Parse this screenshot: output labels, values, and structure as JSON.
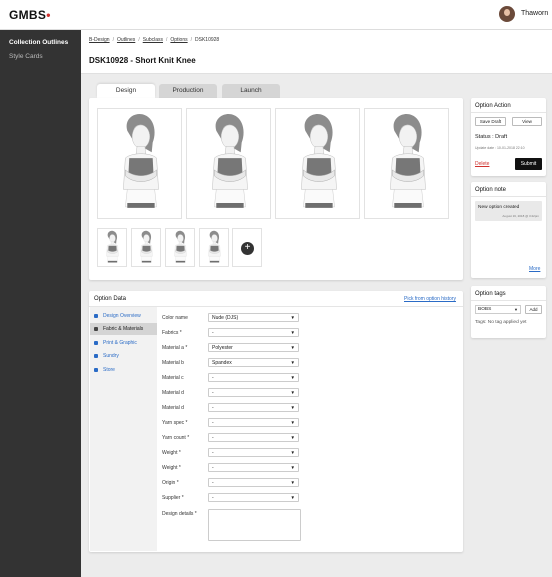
{
  "app": {
    "logo_text": "GMBS",
    "logo_dot": "•",
    "user_name": "Thaworn",
    "accent": "#d0312d"
  },
  "sidebar": {
    "items": [
      {
        "label": "Collection Outlines",
        "active": true
      },
      {
        "label": "Style Cards",
        "active": false
      }
    ]
  },
  "breadcrumb": {
    "items": [
      "B-Design",
      "Outlines",
      "Subclass",
      "Options",
      "DSK10928"
    ],
    "separator": "/"
  },
  "page": {
    "title": "DSK10928 - Short Knit Knee"
  },
  "tabs": [
    {
      "label": "Design",
      "active": true
    },
    {
      "label": "Production",
      "active": false
    },
    {
      "label": "Launch",
      "active": false
    }
  ],
  "gallery": {
    "add_icon": "+"
  },
  "option_action": {
    "title": "Option Action",
    "save_label": "Save Draft",
    "view_label": "View",
    "status_label": "Status : Draft",
    "update_date": "Update date : 10-01-2018 22:10",
    "delete_label": "Delete",
    "submit_label": "Submit"
  },
  "option_note": {
    "title": "Option note",
    "note_text": "New option created",
    "note_date": "August 16, 2018 @ 3:22pm",
    "more_label": "More"
  },
  "option_tags": {
    "title": "Option tags",
    "select_value": "BOBS",
    "add_label": "Add",
    "tags_text": "Tags: No tag applied yet"
  },
  "option_data": {
    "title": "Option Data",
    "pick_link": "Pick from option history",
    "tabs": [
      {
        "label": "Design Overview",
        "icon": "home-icon",
        "active": false
      },
      {
        "label": "Fabric & Materials",
        "icon": "grid-icon",
        "active": true
      },
      {
        "label": "Print & Graphic",
        "icon": "image-icon",
        "active": false
      },
      {
        "label": "Sundry",
        "icon": "sundry-icon",
        "active": false
      },
      {
        "label": "Store",
        "icon": "store-icon",
        "active": false
      }
    ],
    "fields": [
      {
        "label": "Color name",
        "value": "Nude (DJS)"
      },
      {
        "label": "Fabrics *",
        "value": "-"
      },
      {
        "label": "Material a *",
        "value": "Polyester"
      },
      {
        "label": "Material b",
        "value": "Spandex"
      },
      {
        "label": "Material c",
        "value": "-"
      },
      {
        "label": "Material d",
        "value": "-"
      },
      {
        "label": "Material d",
        "value": "-"
      },
      {
        "label": "Yarn spec *",
        "value": "-"
      },
      {
        "label": "Yarn count *",
        "value": "-"
      },
      {
        "label": "Weight *",
        "value": "-"
      },
      {
        "label": "Weight *",
        "value": "-"
      },
      {
        "label": "Origin *",
        "value": "-"
      },
      {
        "label": "Supplier *",
        "value": "-"
      }
    ],
    "textarea_label": "Design details *"
  }
}
